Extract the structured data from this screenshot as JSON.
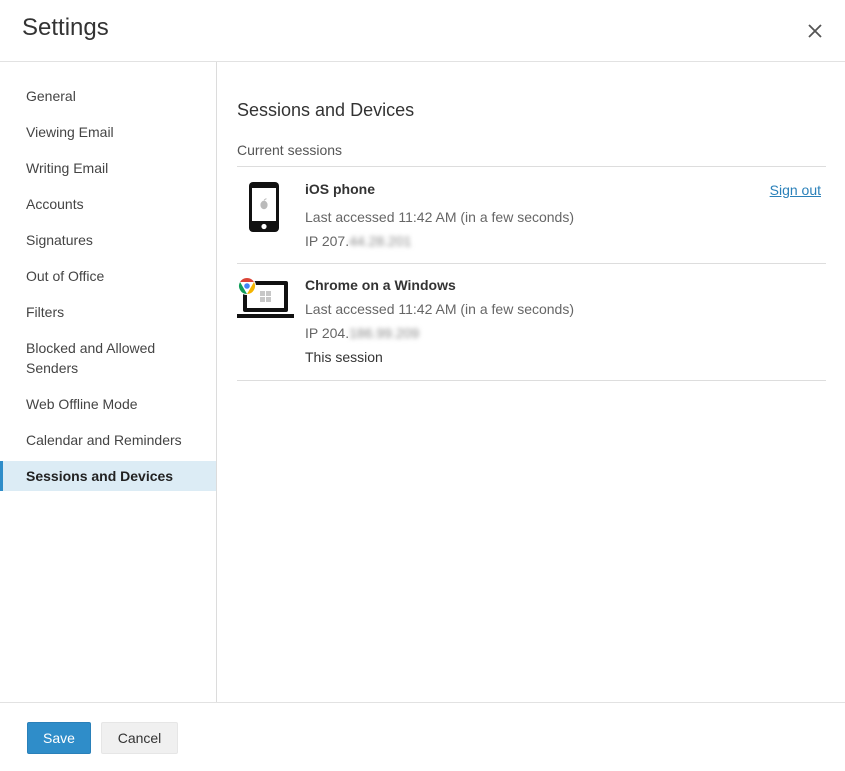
{
  "header": {
    "title": "Settings",
    "close_icon": "close-icon"
  },
  "sidebar": {
    "items": [
      {
        "label": "General"
      },
      {
        "label": "Viewing Email"
      },
      {
        "label": "Writing Email"
      },
      {
        "label": "Accounts"
      },
      {
        "label": "Signatures"
      },
      {
        "label": "Out of Office"
      },
      {
        "label": "Filters"
      },
      {
        "label": "Blocked and Allowed Senders"
      },
      {
        "label": "Web Offline Mode"
      },
      {
        "label": "Calendar and Reminders"
      },
      {
        "label": "Sessions and Devices",
        "active": true
      }
    ]
  },
  "main": {
    "title": "Sessions and Devices",
    "section_label": "Current sessions",
    "sessions": [
      {
        "icon": "phone-icon",
        "name": "iOS phone",
        "last_accessed": "Last accessed 11:42 AM (in a few seconds)",
        "ip_prefix": "IP 207.",
        "ip_blurred": "44.28.201",
        "action": "Sign out"
      },
      {
        "icon": "laptop-icon",
        "name": "Chrome on a Windows",
        "last_accessed": "Last accessed 11:42 AM (in a few seconds)",
        "ip_prefix": "IP 204.",
        "ip_blurred": "186.99.209",
        "note": "This session"
      }
    ]
  },
  "footer": {
    "save_label": "Save",
    "cancel_label": "Cancel"
  },
  "colors": {
    "accent": "#2f8dc9",
    "active_bg": "#dcecf5",
    "link": "#2a80b9"
  }
}
